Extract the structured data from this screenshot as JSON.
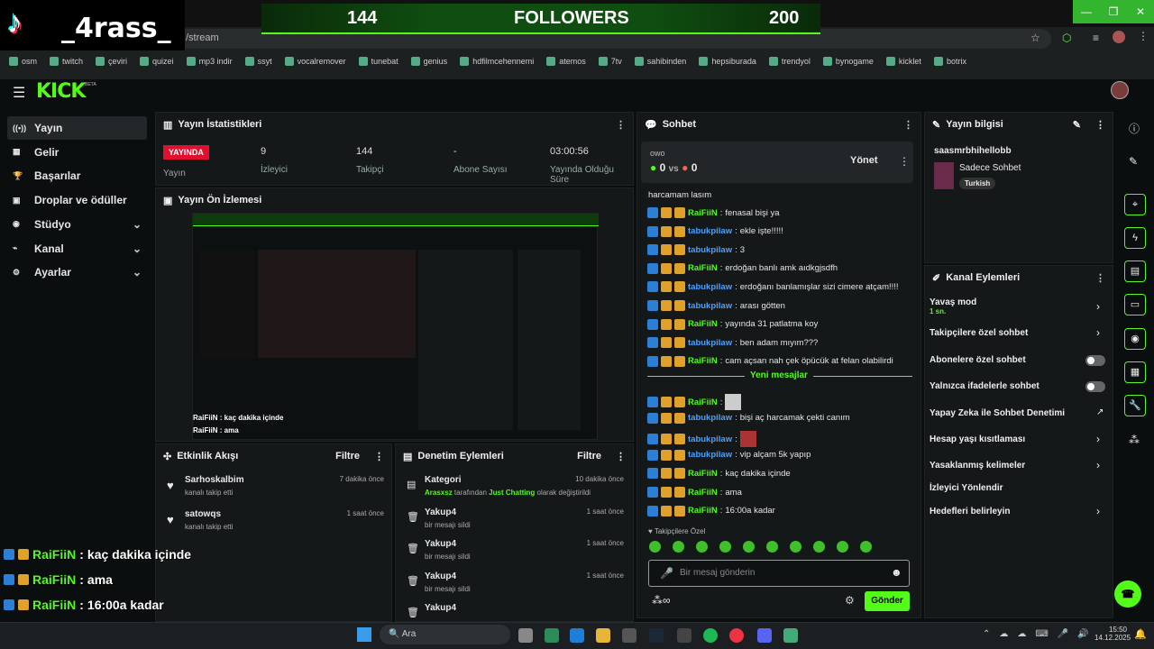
{
  "browser": {
    "address": "/stream",
    "bookmarks": [
      "osm",
      "twitch",
      "çeviri",
      "quizei",
      "mp3 indir",
      "ssyt",
      "vocalremover",
      "tunebat",
      "genius",
      "hdfilmcehennemi",
      "atemos",
      "7tv",
      "sahibinden",
      "hepsiburada",
      "trendyol",
      "bynogame",
      "kicklet",
      "botrix"
    ]
  },
  "overlay": {
    "tiktok_name": "_4rass_",
    "follow_current": "144",
    "follow_label": "FOLLOWERS",
    "follow_goal": "200",
    "chat": [
      {
        "name": "RaiFiiN",
        "msg": "kaç dakika içinde"
      },
      {
        "name": "RaiFiiN",
        "msg": "ama"
      },
      {
        "name": "RaiFiiN",
        "msg": "16:00a kadar"
      }
    ]
  },
  "kick": {
    "logo": "KICK",
    "beta": "BETA"
  },
  "sidebar": [
    {
      "label": "Yayın",
      "icon": "broadcast-icon",
      "active": true
    },
    {
      "label": "Gelir",
      "icon": "money-icon"
    },
    {
      "label": "Başarılar",
      "icon": "trophy-icon"
    },
    {
      "label": "Droplar ve ödüller",
      "icon": "gift-icon"
    },
    {
      "label": "Stüdyo",
      "icon": "studio-icon",
      "chevron": true
    },
    {
      "label": "Kanal",
      "icon": "channel-icon",
      "chevron": true
    },
    {
      "label": "Ayarlar",
      "icon": "settings-icon",
      "chevron": true
    }
  ],
  "stats": {
    "title": "Yayın İstatistikleri",
    "live_badge": "YAYINDA",
    "live_label": "Yayın",
    "viewers": "9",
    "viewers_label": "İzleyici",
    "followers": "144",
    "followers_label": "Takipçi",
    "subs": "-",
    "subs_label": "Abone Sayısı",
    "uptime": "03:00:56",
    "uptime_label": "Yayında Olduğu Süre"
  },
  "preview": {
    "title": "Yayın Ön İzlemesi"
  },
  "activity": {
    "title": "Etkinlik Akışı",
    "filter": "Filtre",
    "items": [
      {
        "name": "Sarhoskalbim",
        "sub": "kanalı takip etti",
        "time": "7 dakika önce"
      },
      {
        "name": "satowqs",
        "sub": "kanalı takip etti",
        "time": "1 saat önce"
      }
    ]
  },
  "moderation": {
    "title": "Denetim Eylemleri",
    "filter": "Filtre",
    "items": [
      {
        "name": "Kategori",
        "sub1": "Arasxsz",
        "sub2": " tarafından ",
        "sub3": "Just Chatting",
        "sub4": " olarak değiştirildi",
        "time": "10 dakika önce"
      },
      {
        "name": "Yakup4",
        "sub": "bir mesajı sildi",
        "time": "1 saat önce"
      },
      {
        "name": "Yakup4",
        "sub": "bir mesajı sildi",
        "time": "1 saat önce"
      },
      {
        "name": "Yakup4",
        "sub": "bir mesajı sildi",
        "time": "1 saat önce"
      },
      {
        "name": "Yakup4",
        "sub": "",
        "time": ""
      }
    ]
  },
  "chat": {
    "title": "Sohbet",
    "poll_owner": "owo",
    "score_a": "0",
    "vs": "vs",
    "score_b": "0",
    "manage": "Yönet",
    "new_messages": "Yeni mesajlar",
    "followers_only": "Takipçilere Özel",
    "input_placeholder": "Bir mesaj gönderin",
    "send": "Gönder",
    "first_line": "harcamam lasım",
    "messages": [
      {
        "name": "RaiFiiN",
        "c": "g",
        "msg": "fenasal bişi ya"
      },
      {
        "name": "tabukpilaw",
        "c": "b",
        "msg": "ekle işte!!!!!"
      },
      {
        "name": "tabukpilaw",
        "c": "b",
        "msg": "3"
      },
      {
        "name": "RaiFiiN",
        "c": "g",
        "msg": "erdoğan banlı amk aıdkgjsdfh"
      },
      {
        "name": "tabukpilaw",
        "c": "b",
        "msg": "erdoğanı banlamışlar sizi cimere atçam!!!!"
      },
      {
        "name": "tabukpilaw",
        "c": "b",
        "msg": "arası götten"
      },
      {
        "name": "RaiFiiN",
        "c": "g",
        "msg": "yayında 31 patlatma koy"
      },
      {
        "name": "tabukpilaw",
        "c": "b",
        "msg": "ben adam mıyım???"
      },
      {
        "name": "RaiFiiN",
        "c": "g",
        "msg": "cam açsan nah çek öpücük at felan olabilirdi"
      }
    ],
    "messages2": [
      {
        "name": "RaiFiiN",
        "c": "g",
        "msg": ""
      },
      {
        "name": "tabukpilaw",
        "c": "b",
        "msg": "bişi aç harcamak çekti canım"
      },
      {
        "name": "tabukpilaw",
        "c": "b",
        "msg": ""
      },
      {
        "name": "tabukpilaw",
        "c": "b",
        "msg": "vip alçam 5k yapıp"
      },
      {
        "name": "RaiFiiN",
        "c": "g",
        "msg": "kaç dakika içinde"
      },
      {
        "name": "RaiFiiN",
        "c": "g",
        "msg": "ama"
      },
      {
        "name": "RaiFiiN",
        "c": "g",
        "msg": "16:00a kadar"
      }
    ]
  },
  "info": {
    "title": "Yayın bilgisi",
    "stream_title": "saasmrbhihellobb",
    "category": "Sadece Sohbet",
    "language": "Turkish"
  },
  "actions": {
    "title": "Kanal Eylemleri",
    "slow": "Yavaş mod",
    "slow_val": "1 sn.",
    "followers": "Takipçilere özel sohbet",
    "subs": "Abonelere özel sohbet",
    "emotes": "Yalnızca ifadelerle sohbet",
    "ai": "Yapay Zeka ile Sohbet Denetimi",
    "age": "Hesap yaşı kısıtlaması",
    "banned": "Yasaklanmış kelimeler",
    "redirect": "İzleyici Yönlendir",
    "goals": "Hedefleri belirleyin"
  },
  "taskbar": {
    "search": "Ara",
    "time": "15:50",
    "date": "14.12.2025"
  }
}
